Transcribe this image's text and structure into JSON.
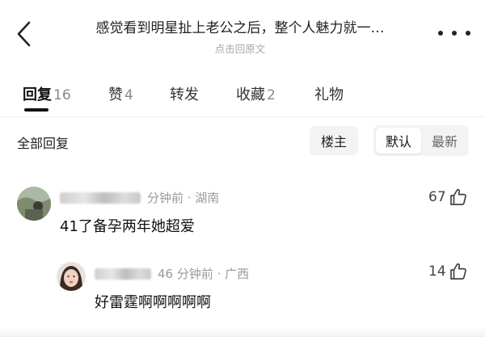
{
  "header": {
    "title": "感觉看到明星扯上老公之后，整个人魅力就一…",
    "subtitle": "点击回原文",
    "back_icon": "chevron-left-icon",
    "more_icon": "more-horizontal-icon"
  },
  "tabs": [
    {
      "label": "回复",
      "count": "16",
      "active": true
    },
    {
      "label": "赞",
      "count": "4",
      "active": false
    },
    {
      "label": "转发",
      "count": "",
      "active": false
    },
    {
      "label": "收藏",
      "count": "2",
      "active": false
    },
    {
      "label": "礼物",
      "count": "",
      "active": false
    }
  ],
  "filter": {
    "title": "全部回复",
    "op_label": "楼主",
    "sort_options": [
      "默认",
      "最新"
    ],
    "sort_selected": "默认"
  },
  "comments": [
    {
      "meta": "分钟前 · 湖南",
      "content": "41了备孕两年她超爱",
      "likes": "67",
      "like_icon": "thumbs-up-icon"
    },
    {
      "meta": "46 分钟前 · 广西",
      "content": "好雷霆啊啊啊啊啊",
      "likes": "14",
      "like_icon": "thumbs-up-icon"
    }
  ],
  "colors": {
    "text_primary": "#111111",
    "text_secondary": "#9a9a9a",
    "pill_bg": "#f3f3f3",
    "divider": "#eeeeee"
  }
}
